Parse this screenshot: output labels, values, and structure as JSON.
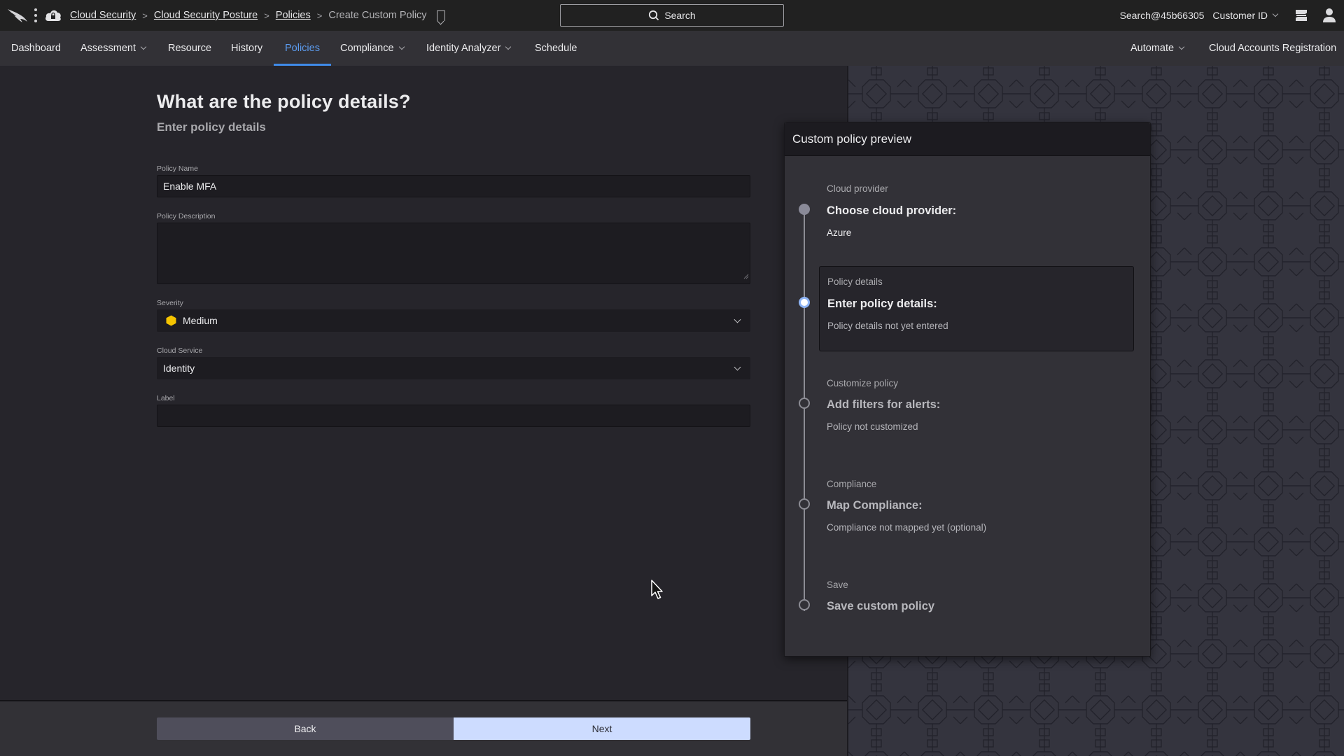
{
  "topbar": {
    "logo": "falcon-logo-icon",
    "breadcrumb": [
      {
        "label": "Cloud Security",
        "link": true
      },
      {
        "label": "Cloud Security Posture",
        "link": true
      },
      {
        "label": "Policies",
        "link": true
      },
      {
        "label": "Create Custom Policy",
        "link": false
      }
    ],
    "search_label": "Search",
    "account": "Search@45b66305",
    "customer_id_label": "Customer ID"
  },
  "nav": {
    "items": [
      {
        "label": "Dashboard",
        "dropdown": false
      },
      {
        "label": "Assessment",
        "dropdown": true
      },
      {
        "label": "Resource",
        "dropdown": false
      },
      {
        "label": "History",
        "dropdown": false
      },
      {
        "label": "Policies",
        "dropdown": false,
        "active": true
      },
      {
        "label": "Compliance",
        "dropdown": true
      },
      {
        "label": "Identity Analyzer",
        "dropdown": true
      },
      {
        "label": "Schedule",
        "dropdown": false
      }
    ],
    "right_items": [
      {
        "label": "Automate",
        "dropdown": true
      },
      {
        "label": "Cloud Accounts Registration",
        "dropdown": false
      }
    ]
  },
  "form": {
    "title": "What are the policy details?",
    "subtitle": "Enter policy details",
    "policy_name_label": "Policy Name",
    "policy_name_value": "Enable MFA",
    "policy_description_label": "Policy Description",
    "policy_description_value": "",
    "severity_label": "Severity",
    "severity_value": "Medium",
    "severity_color": "#f5c400",
    "cloud_service_label": "Cloud Service",
    "cloud_service_value": "Identity",
    "label_label": "Label",
    "label_value": ""
  },
  "footer": {
    "back_label": "Back",
    "next_label": "Next"
  },
  "preview": {
    "title": "Custom policy preview",
    "steps": [
      {
        "category": "Cloud provider",
        "title": "Choose cloud provider:",
        "description": "Azure",
        "state": "done"
      },
      {
        "category": "Policy details",
        "title": "Enter policy details:",
        "description": "Policy details not yet entered",
        "state": "current"
      },
      {
        "category": "Customize policy",
        "title": "Add filters for alerts:",
        "description": "Policy not customized",
        "state": "todo"
      },
      {
        "category": "Compliance",
        "title": "Map Compliance:",
        "description": "Compliance not mapped yet (optional)",
        "state": "todo"
      },
      {
        "category": "Save",
        "title": "Save custom policy",
        "description": "",
        "state": "todo"
      }
    ]
  },
  "colors": {
    "accent": "#3f8ae8",
    "next_button": "#cddcff",
    "current_step": "#8eb4f5"
  }
}
